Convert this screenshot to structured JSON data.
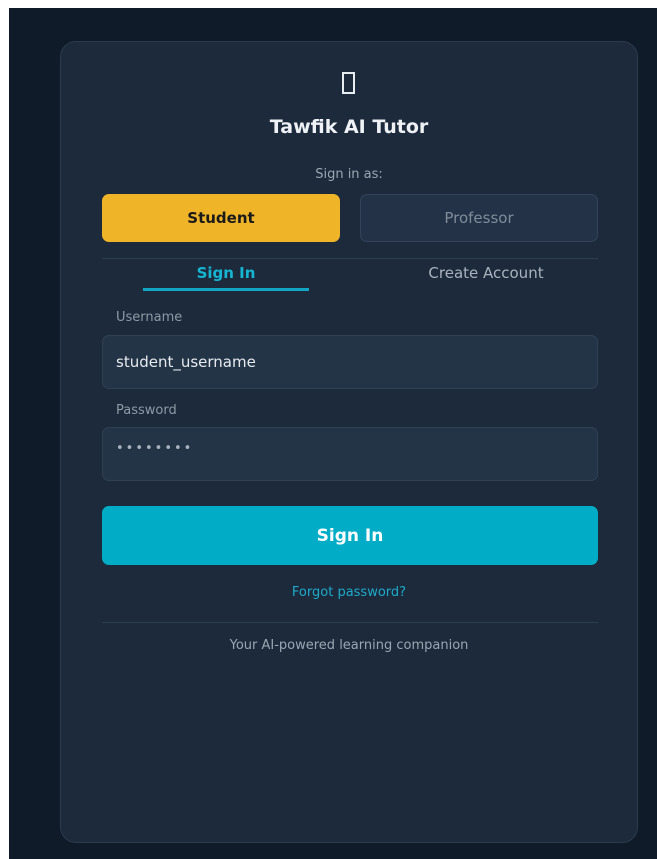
{
  "app": {
    "title": "Tawfik AI Tutor",
    "logo_icon": "missing-glyph-icon"
  },
  "role_selector": {
    "prompt": "Sign in as:",
    "options": [
      "Student",
      "Professor"
    ],
    "selected": "Student"
  },
  "tabs": {
    "items": [
      "Sign In",
      "Create Account"
    ],
    "active": "Sign In"
  },
  "form": {
    "username_label": "Username",
    "username_value": "student_username",
    "password_label": "Password",
    "password_value": "••••••••"
  },
  "actions": {
    "submit_label": "Sign In",
    "forgot_label": "Forgot password?"
  },
  "footer": {
    "tagline": "Your AI-powered learning companion"
  },
  "colors": {
    "background": "#0f1b29",
    "card": "#1c2a3b",
    "accent_student": "#f0b429",
    "accent_primary": "#00acc6",
    "link": "#1eaacb"
  }
}
